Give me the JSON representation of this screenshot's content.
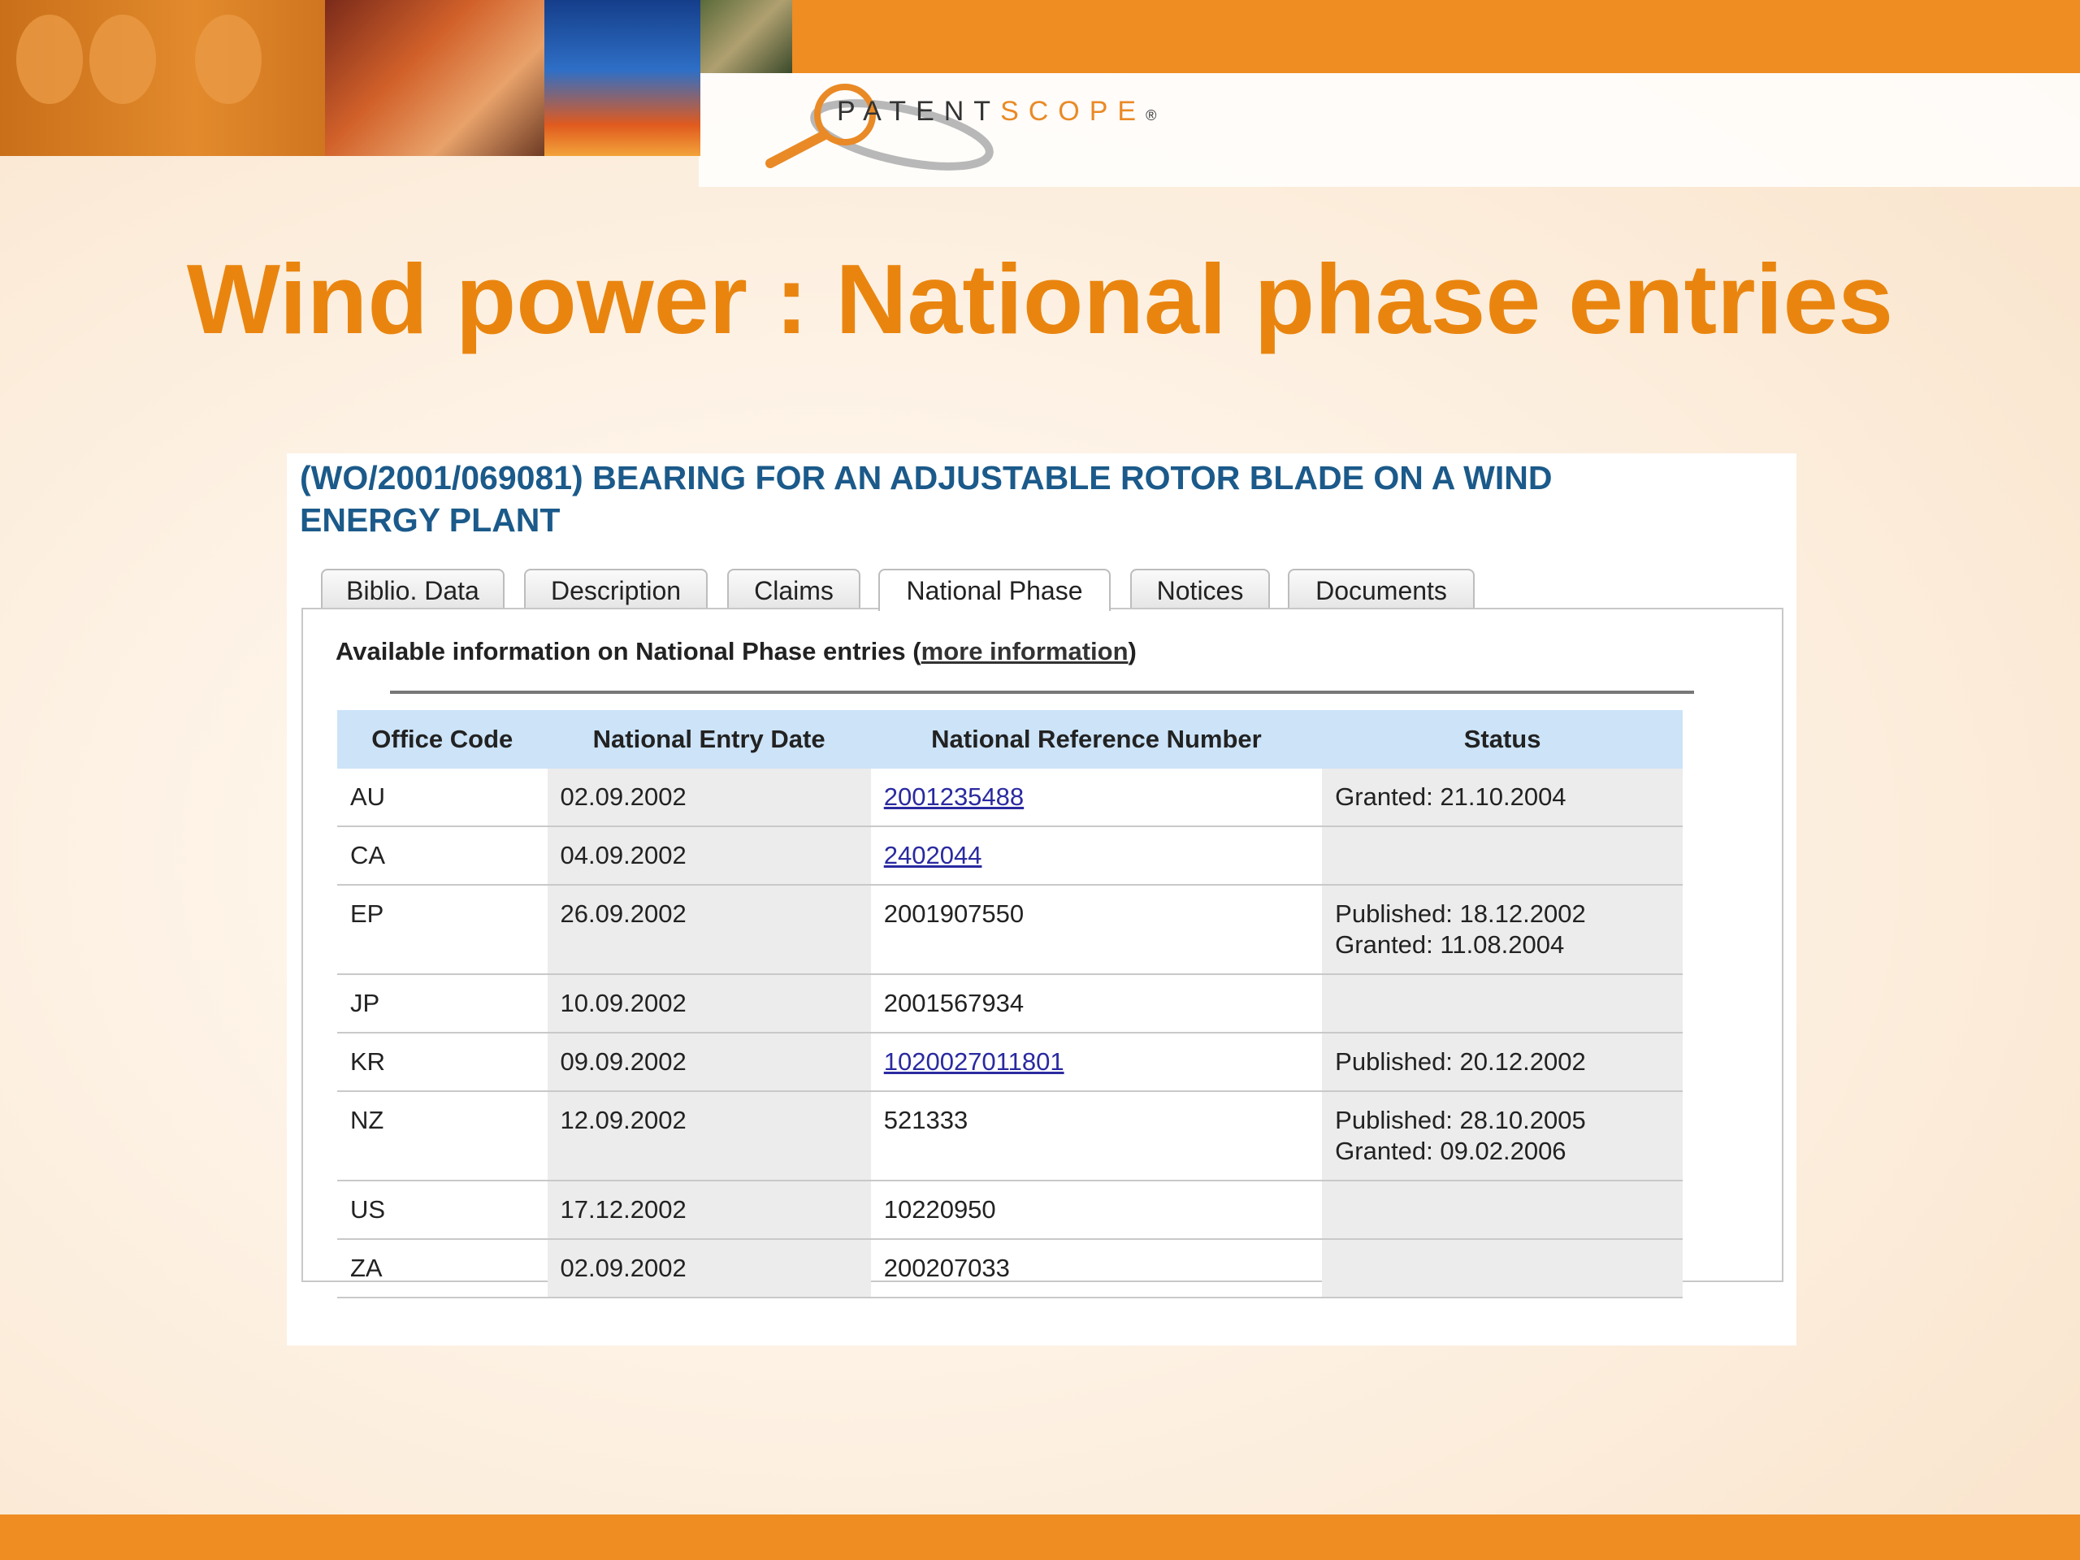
{
  "logo": {
    "text_main": "PATENT",
    "text_accent": "SCOPE",
    "reg": "®"
  },
  "slide_title": "Wind power : National phase entries",
  "document_title": "(WO/2001/069081) BEARING FOR AN ADJUSTABLE ROTOR BLADE ON A WIND ENERGY PLANT",
  "tabs": [
    {
      "label": "Biblio. Data",
      "active": false
    },
    {
      "label": "Description",
      "active": false
    },
    {
      "label": "Claims",
      "active": false
    },
    {
      "label": "National Phase",
      "active": true
    },
    {
      "label": "Notices",
      "active": false
    },
    {
      "label": "Documents",
      "active": false
    }
  ],
  "info": {
    "prefix": "Available information on National Phase entries (",
    "link": "more information",
    "suffix": ")"
  },
  "table": {
    "headers": [
      "Office Code",
      "National Entry Date",
      "National Reference Number",
      "Status"
    ],
    "rows": [
      {
        "office": "AU",
        "date": "02.09.2002",
        "ref": "2001235488",
        "ref_link": true,
        "status": [
          "Granted: 21.10.2004"
        ]
      },
      {
        "office": "CA",
        "date": "04.09.2002",
        "ref": "2402044",
        "ref_link": true,
        "status": []
      },
      {
        "office": "EP",
        "date": "26.09.2002",
        "ref": "2001907550",
        "ref_link": false,
        "status": [
          "Published: 18.12.2002",
          "Granted: 11.08.2004"
        ]
      },
      {
        "office": "JP",
        "date": "10.09.2002",
        "ref": "2001567934",
        "ref_link": false,
        "status": []
      },
      {
        "office": "KR",
        "date": "09.09.2002",
        "ref": "1020027011801",
        "ref_link": true,
        "status": [
          "Published: 20.12.2002"
        ]
      },
      {
        "office": "NZ",
        "date": "12.09.2002",
        "ref": "521333",
        "ref_link": false,
        "status": [
          "Published: 28.10.2005",
          "Granted: 09.02.2006"
        ]
      },
      {
        "office": "US",
        "date": "17.12.2002",
        "ref": "10220950",
        "ref_link": false,
        "status": []
      },
      {
        "office": "ZA",
        "date": "02.09.2002",
        "ref": "200207033",
        "ref_link": false,
        "status": []
      }
    ]
  },
  "colors": {
    "accent_orange": "#e9850f",
    "title_blue": "#1b5a8a",
    "header_blue": "#cce3f8",
    "link": "#2a2aa0"
  }
}
